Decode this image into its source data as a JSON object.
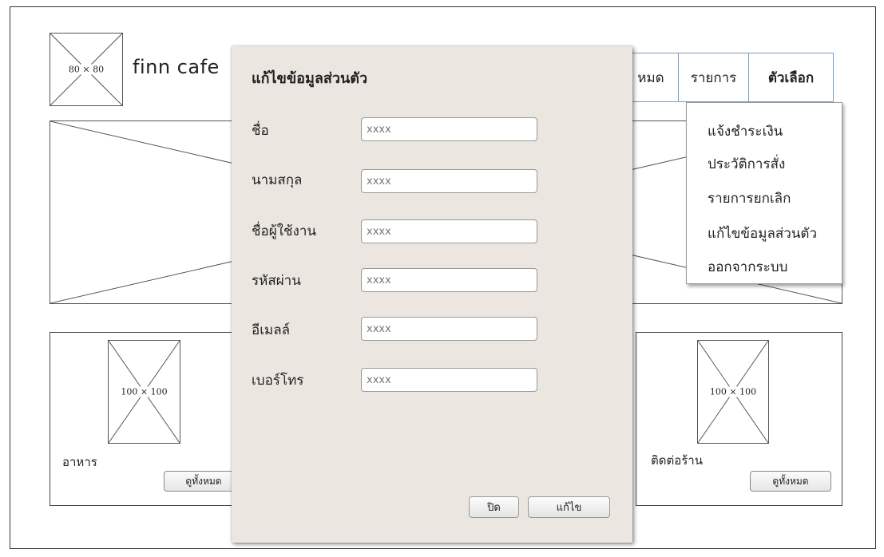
{
  "header": {
    "logo_placeholder": "80 × 80",
    "brand": "finn cafe"
  },
  "nav": {
    "items": [
      {
        "label": "หมด"
      },
      {
        "label": "รายการ"
      },
      {
        "label": "ตัวเลือก"
      }
    ]
  },
  "dropdown": {
    "items": [
      {
        "label": "แจ้งชำระเงิน"
      },
      {
        "label": "ประวัติการสั่ง"
      },
      {
        "label": "รายการยกเลิก"
      },
      {
        "label": "แก้ไขข้อมูลส่วนตัว"
      },
      {
        "label": "ออกจากระบบ"
      }
    ]
  },
  "cards": {
    "left": {
      "image_placeholder": "100 × 100",
      "label": "อาหาร",
      "button": "ดูทั้งหมด"
    },
    "right": {
      "image_placeholder": "100 × 100",
      "label": "ติดต่อร้าน",
      "button": "ดูทั้งหมด"
    }
  },
  "dialog": {
    "title": "แก้ไขข้อมูลส่วนตัว",
    "fields": [
      {
        "label": "ชื่อ",
        "placeholder": "xxxx"
      },
      {
        "label": "นามสกุล",
        "placeholder": "xxxx"
      },
      {
        "label": "ชื่อผู้ใช้งาน",
        "placeholder": "xxxx"
      },
      {
        "label": "รหัสผ่าน",
        "placeholder": "xxxx"
      },
      {
        "label": "อีเมลล์",
        "placeholder": "xxxx"
      },
      {
        "label": "เบอร์โทร",
        "placeholder": "xxxx"
      }
    ],
    "close_button": "ปิด",
    "edit_button": "แก้ไข"
  }
}
